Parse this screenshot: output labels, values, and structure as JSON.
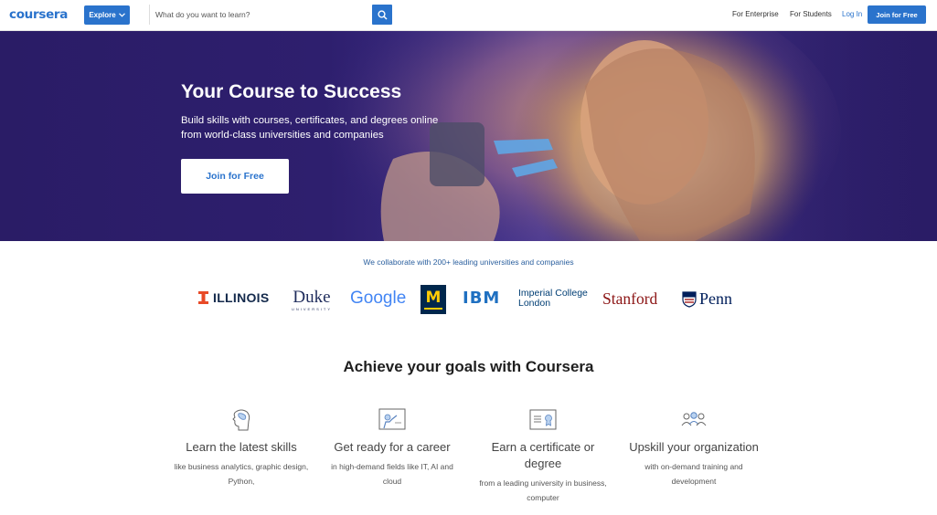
{
  "header": {
    "logo": "coursera",
    "explore_label": "Explore",
    "search_placeholder": "What do you want to learn?",
    "nav": {
      "enterprise": "For Enterprise",
      "students": "For Students",
      "login": "Log In",
      "join": "Join for Free"
    }
  },
  "hero": {
    "title": "Your Course to Success",
    "subtitle": "Build skills with courses, certificates, and degrees online from world-class universities and companies",
    "cta": "Join for Free"
  },
  "partners": {
    "heading": "We collaborate with 200+ leading universities and companies",
    "logos": {
      "illinois": "ILLINOIS",
      "duke": "Duke",
      "duke_sub": "UNIVERSITY",
      "google": "Google",
      "michigan": "M",
      "ibm": "IBM",
      "imperial_line1": "Imperial College",
      "imperial_line2": "London",
      "stanford": "Stanford",
      "penn": "Penn"
    }
  },
  "goals": {
    "title": "Achieve your goals with Coursera",
    "items": [
      {
        "title": "Learn the latest skills",
        "desc": "like business analytics, graphic design, Python,",
        "icon": "brain-icon"
      },
      {
        "title": "Get ready for a career",
        "desc": "in high-demand fields like IT, AI and cloud",
        "icon": "presentation-icon"
      },
      {
        "title": "Earn a certificate or degree",
        "desc": "from a leading university in business, computer",
        "icon": "certificate-icon"
      },
      {
        "title": "Upskill your organization",
        "desc": "with on-demand training and development",
        "icon": "team-icon"
      }
    ]
  },
  "colors": {
    "brand_blue": "#2a73cc",
    "hero_purple": "#2a1c66"
  }
}
